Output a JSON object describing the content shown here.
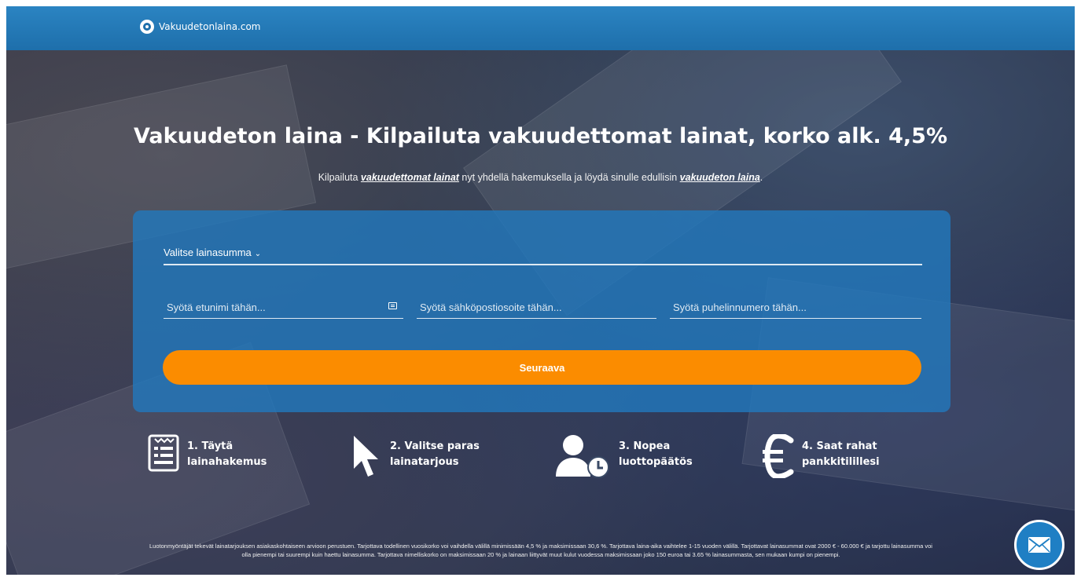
{
  "header": {
    "logo_text": "Vakuudetonlaina.com",
    "bg_color": "#1e6fab"
  },
  "hero": {
    "headline": "Vakuudeton laina - Kilpailuta vakuudettomat lainat, korko alk. 4,5%",
    "sub_prefix": "Kilpailuta ",
    "sub_link1": "vakuudettomat lainat",
    "sub_middle": " nyt yhdellä hakemuksella ja löydä sinulle edullisin ",
    "sub_link2": "vakuudeton laina",
    "sub_suffix": "."
  },
  "form": {
    "amount_select_label": "Valitse lainasumma",
    "firstname_placeholder": "Syötä etunimi tähän...",
    "email_placeholder": "Syötä sähköpostiosoite tähän...",
    "phone_placeholder": "Syötä puhelinnumero tähän...",
    "submit_label": "Seuraava",
    "card_color": "#2278bc",
    "button_color": "#fb8c00"
  },
  "steps": [
    {
      "line1": "1. Täytä",
      "line2": "lainahakemus",
      "icon": "form-icon"
    },
    {
      "line1": "2. Valitse paras",
      "line2": "lainatarjous",
      "icon": "cursor-icon"
    },
    {
      "line1": "3. Nopea",
      "line2": "luottopäätös",
      "icon": "user-clock-icon"
    },
    {
      "line1": "4. Saat rahat",
      "line2": "pankkitilillesi",
      "icon": "euro-icon"
    }
  ],
  "disclaimer": "Luotonmyöntäjät tekevät lainatarjouksen asiakaskohtaiseen arvioon perustuen. Tarjottava todellinen vuosikorko voi vaihdella välillä minimissään 4,5 % ja maksimissaan 30,6 %. Tarjottava laina-aika vaihtelee 1-15 vuoden välillä. Tarjottavat lainasummat ovat 2000 € - 60.000 € ja tarjottu lainasumma voi olla pienempi tai suurempi kuin haettu lainasumma. Tarjottava nimelliskorko on maksimissaan 20 % ja lainaan liittyvät muut kulut vuodessa maksimissaan joko 150 euroa tai 3.65 % lainasummasta, sen mukaan kumpi on pienempi.",
  "chat": {
    "icon": "mail-icon"
  }
}
